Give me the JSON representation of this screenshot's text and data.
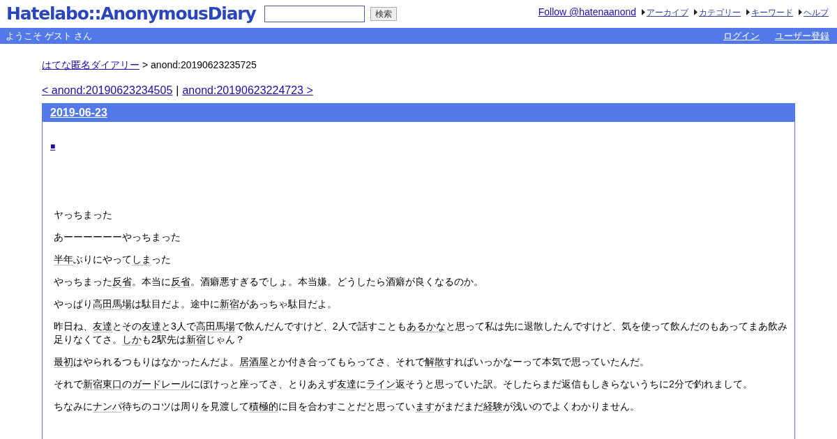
{
  "header": {
    "logo": "Hatelabo::AnonymousDiary",
    "search_button": "検索",
    "follow_link": "Follow @hatenaanond",
    "nav_links": [
      "アーカイブ",
      "カテゴリー",
      "キーワード",
      "ヘルプ"
    ]
  },
  "welcome_bar": {
    "greeting": "ようこそ ゲスト さん",
    "links": [
      "ログイン",
      "ユーザー登録"
    ]
  },
  "breadcrumb": {
    "link": "はてな匿名ダイアリー",
    "text": "> anond:20190623235725"
  },
  "pager": {
    "prev": "< anond:20190623234505",
    "separator": "|",
    "next": "anond:20190623224723 >"
  },
  "entry": {
    "date": "2019-06-23",
    "marker": "■",
    "paragraphs": [
      [
        {
          "text": "ヤっちまった",
          "keyword": false
        }
      ],
      [
        {
          "text": "あーーーーーーやっちまった",
          "keyword": false
        }
      ],
      [
        {
          "text": "半年",
          "keyword": true
        },
        {
          "text": "ぶりにやって",
          "keyword": false
        },
        {
          "text": "しま",
          "keyword": true
        },
        {
          "text": "った",
          "keyword": false
        }
      ],
      [
        {
          "text": "やっちまった",
          "keyword": false
        },
        {
          "text": "反省",
          "keyword": true
        },
        {
          "text": "。本当に",
          "keyword": false
        },
        {
          "text": "反省",
          "keyword": true
        },
        {
          "text": "。酒癖悪すぎるでしょ。本当嫌。どうしたら酒癖が良くなるのか。",
          "keyword": false
        }
      ],
      [
        {
          "text": "やっぱり",
          "keyword": false
        },
        {
          "text": "高田馬場",
          "keyword": true
        },
        {
          "text": "は駄目だよ。途中に",
          "keyword": false
        },
        {
          "text": "新宿",
          "keyword": true
        },
        {
          "text": "があっちゃ駄目だよ。",
          "keyword": false
        }
      ],
      [
        {
          "text": "昨日ね、",
          "keyword": false
        },
        {
          "text": "友達",
          "keyword": true
        },
        {
          "text": "とその",
          "keyword": false
        },
        {
          "text": "友達",
          "keyword": true
        },
        {
          "text": "と3人で",
          "keyword": false
        },
        {
          "text": "高田馬場",
          "keyword": true
        },
        {
          "text": "で飲んだんですけど、2人で話すことも",
          "keyword": false
        },
        {
          "text": "あるかな",
          "keyword": true
        },
        {
          "text": "と思って私は先に退散したんですけど、気を使って飲んだのもあってまあ飲み足りなくてさ。",
          "keyword": false
        },
        {
          "text": "しか",
          "keyword": true
        },
        {
          "text": "も2駅先は",
          "keyword": false
        },
        {
          "text": "新宿",
          "keyword": true
        },
        {
          "text": "じゃん？",
          "keyword": false
        }
      ],
      [
        {
          "text": "最初",
          "keyword": true
        },
        {
          "text": "はやられるつもりはなかったんだよ。",
          "keyword": false
        },
        {
          "text": "居酒屋",
          "keyword": true
        },
        {
          "text": "とか付き合ってもらってさ、それで",
          "keyword": false
        },
        {
          "text": "解散",
          "keyword": true
        },
        {
          "text": "すればいっかなーって本気で思っていたんだ。",
          "keyword": false
        }
      ],
      [
        {
          "text": "それで",
          "keyword": false
        },
        {
          "text": "新宿東口",
          "keyword": true
        },
        {
          "text": "の",
          "keyword": false
        },
        {
          "text": "ガードレール",
          "keyword": true
        },
        {
          "text": "にぼけっと座ってさ、とりあえず",
          "keyword": false
        },
        {
          "text": "友達",
          "keyword": true
        },
        {
          "text": "に",
          "keyword": false
        },
        {
          "text": "ライン",
          "keyword": true
        },
        {
          "text": "返そうと思っていた訳。そしたらまだ返信もしきらないうちに2分で釣れまして。",
          "keyword": false
        }
      ],
      [
        {
          "text": "ちなみに",
          "keyword": false
        },
        {
          "text": "ナンパ",
          "keyword": true
        },
        {
          "text": "待ちのコツは周りを見渡して",
          "keyword": false
        },
        {
          "text": "積極的",
          "keyword": true
        },
        {
          "text": "に目を合わすことだと思ってい",
          "keyword": false
        },
        {
          "text": "ます",
          "keyword": true
        },
        {
          "text": "がまだまだ",
          "keyword": false
        },
        {
          "text": "経験",
          "keyword": true
        },
        {
          "text": "が浅いのでよくわかりません。",
          "keyword": false
        }
      ]
    ]
  }
}
